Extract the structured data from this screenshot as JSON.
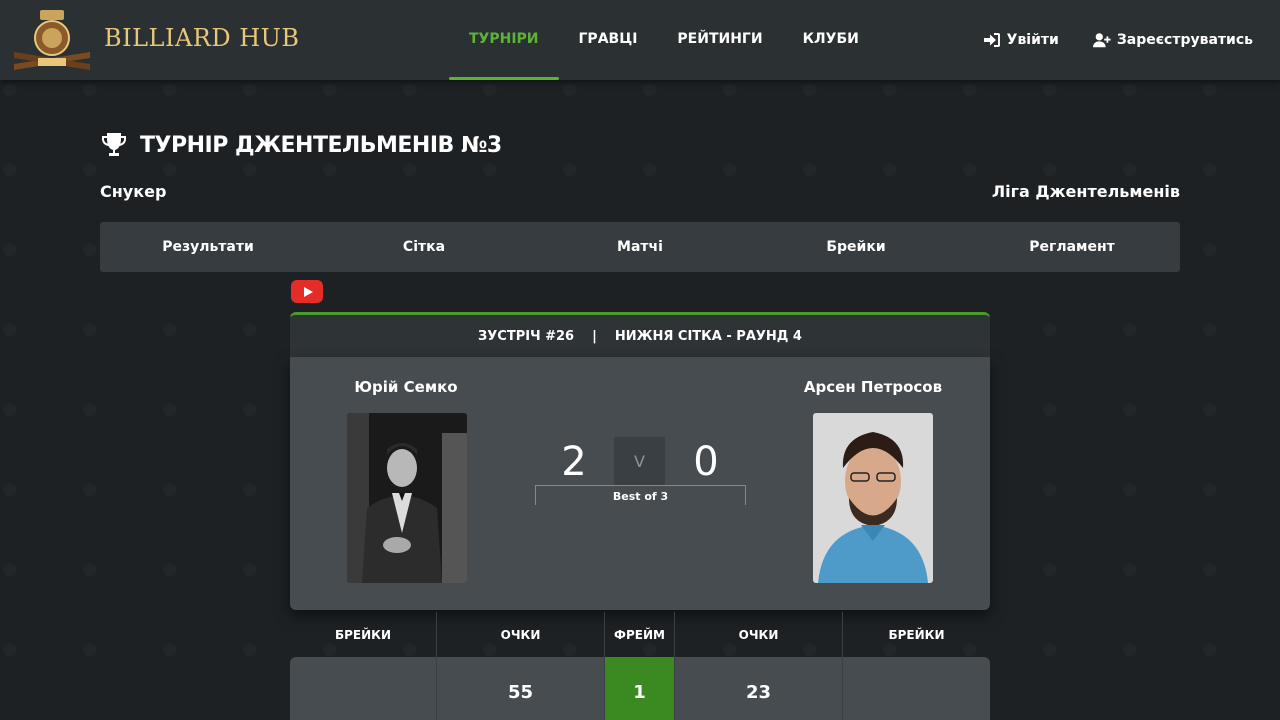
{
  "header": {
    "brand": "BILLIARD HUB",
    "nav": [
      {
        "label": "ТУРНІРИ",
        "active": true
      },
      {
        "label": "ГРАВЦІ",
        "active": false
      },
      {
        "label": "РЕЙТИНГИ",
        "active": false
      },
      {
        "label": "КЛУБИ",
        "active": false
      }
    ],
    "login_label": "Увійти",
    "register_label": "Зареєструватись",
    "accent_color": "#5bb535",
    "brand_color": "#e8c77a"
  },
  "tournament": {
    "title": "ТУРНІР ДЖЕНТЕЛЬМЕНІВ №3",
    "discipline": "Снукер",
    "league": "Ліга Джентельменів",
    "tabs": [
      "Результати",
      "Сітка",
      "Матчі",
      "Брейки",
      "Регламент"
    ]
  },
  "match": {
    "number": "ЗУСТРІЧ #26",
    "separator": "|",
    "stage": "НИЖНЯ СІТКА - РАУНД 4",
    "player1": {
      "name": "Юрій Семко",
      "score": "2"
    },
    "player2": {
      "name": "Арсен Петросов",
      "score": "0"
    },
    "versus": "V",
    "best_of": "Best of 3"
  },
  "frames": {
    "headers": [
      "БРЕЙКИ",
      "ОЧКИ",
      "ФРЕЙМ",
      "ОЧКИ",
      "БРЕЙКИ"
    ],
    "rows": [
      {
        "breaks1": "",
        "points1": "55",
        "frame": "1",
        "points2": "23",
        "breaks2": ""
      }
    ]
  }
}
